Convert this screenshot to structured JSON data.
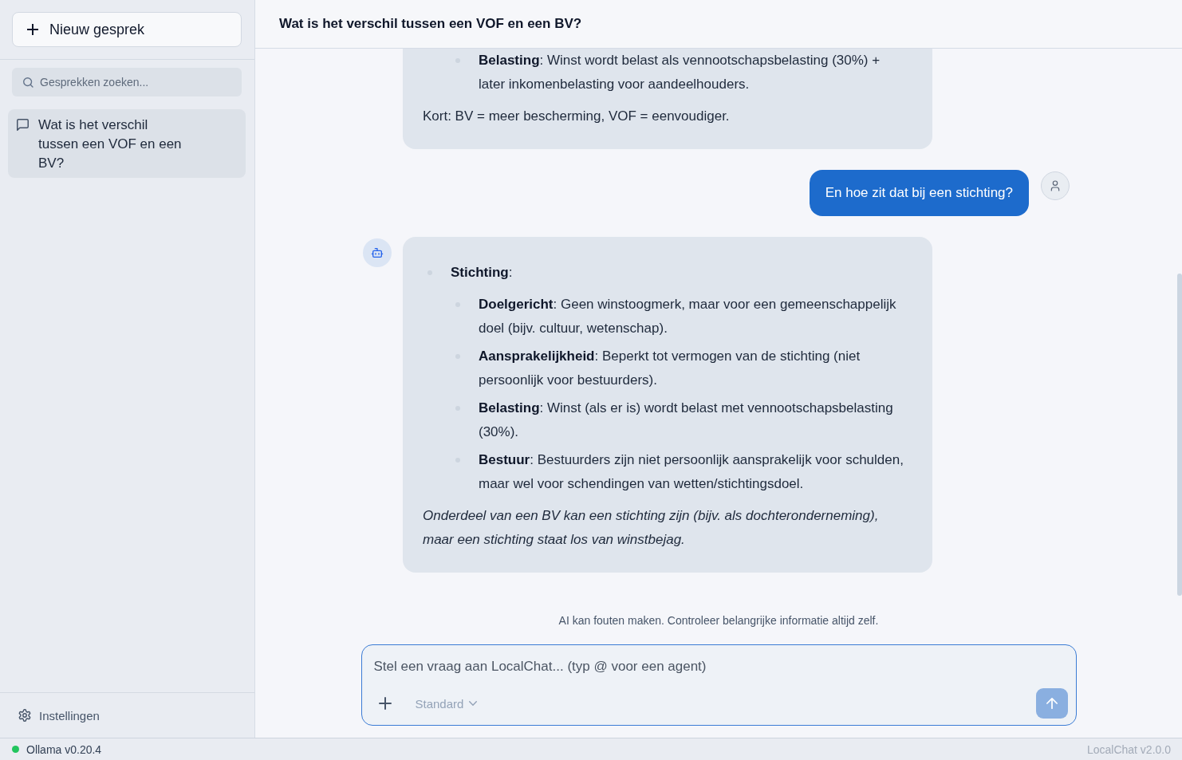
{
  "sidebar": {
    "new_chat_button": {
      "label": "Nieuw gesprek"
    },
    "search": {
      "placeholder": "Gesprekken zoeken..."
    },
    "conversations": [
      {
        "title": "Wat is het verschil tussen een VOF en een BV?",
        "selected": true
      }
    ],
    "settings": {
      "label": "Instellingen"
    }
  },
  "chat": {
    "title": "Wat is het verschil tussen een VOF en een BV?",
    "messages": [
      {
        "kind": "assistant",
        "cut_top": true,
        "blocks": [
          {
            "kind": "list",
            "items": [
              {
                "children": [
                  {
                    "text": "**Belasting**: Winst wordt belast als vennootschapsbelasting (30%) + later inkomenbelasting voor aandeelhouders."
                  }
                ]
              }
            ]
          },
          {
            "kind": "paragraph",
            "italic": false,
            "text": "Kort: BV = meer bescherming, VOF = eenvoudiger."
          }
        ]
      },
      {
        "kind": "user",
        "text": "En hoe zit dat bij een stichting?"
      },
      {
        "kind": "assistant",
        "cut_top": false,
        "blocks": [
          {
            "kind": "list",
            "items": [
              {
                "text": "**Stichting**:",
                "children": [
                  {
                    "text": "**Doelgericht**: Geen winstoogmerk, maar voor een gemeenschappelijk doel (bijv. cultuur, wetenschap)."
                  },
                  {
                    "text": "**Aansprakelijkheid**: Beperkt tot vermogen van de stichting (niet persoonlijk voor bestuurders)."
                  },
                  {
                    "text": "**Belasting**: Winst (als er is) wordt belast met vennootschapsbelasting (30%)."
                  },
                  {
                    "text": "**Bestuur**: Bestuurders zijn niet persoonlijk aansprakelijk voor schulden, maar wel voor schendingen van wetten/stichtingsdoel."
                  }
                ]
              }
            ]
          },
          {
            "kind": "paragraph",
            "italic": true,
            "text": "Onderdeel van een BV kan een stichting zijn (bijv. als dochteronderneming), maar een stichting staat los van winstbejag."
          }
        ]
      }
    ],
    "disclaimer": "AI kan fouten maken. Controleer belangrijke informatie altijd zelf.",
    "composer": {
      "placeholder": "Stel een vraag aan LocalChat... (typ @ voor een agent)",
      "mode": "Standard",
      "send_disabled": true
    }
  },
  "status_bar": {
    "connection": {
      "label": "Ollama v0.20.4",
      "connected": true
    },
    "version": "LocalChat v2.0.0"
  }
}
